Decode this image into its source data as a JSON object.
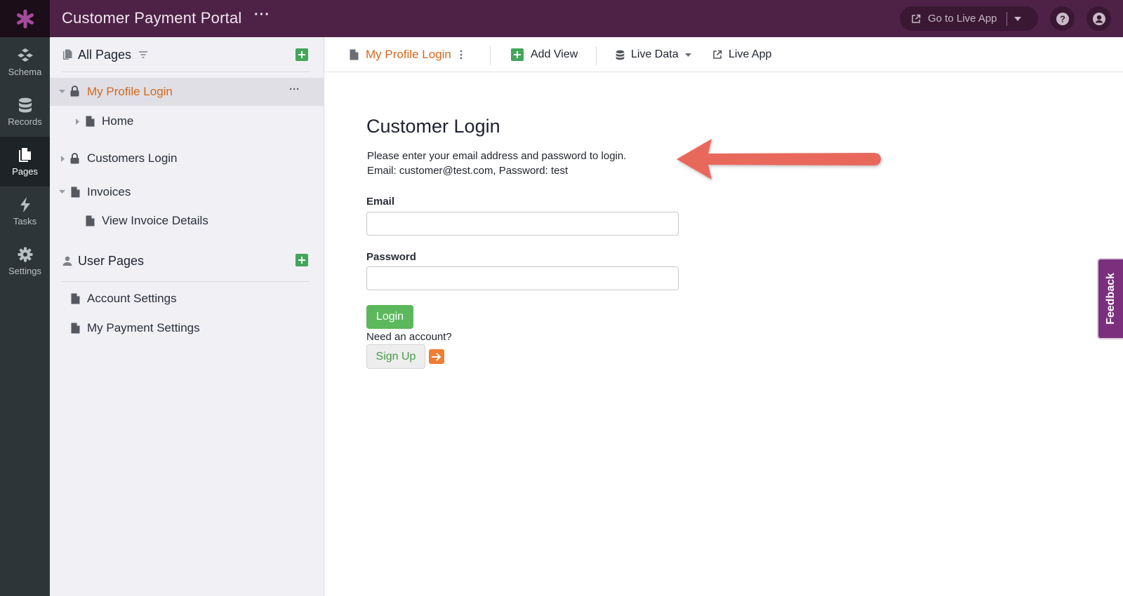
{
  "app": {
    "title": "Customer Payment Portal",
    "more_label": "···",
    "go_live_label": "Go to Live App",
    "accent": "#4e2247"
  },
  "leftnav": {
    "items": [
      {
        "label": "Schema",
        "icon": "schema-icon"
      },
      {
        "label": "Records",
        "icon": "database-icon"
      },
      {
        "label": "Pages",
        "icon": "pages-icon",
        "active": true
      },
      {
        "label": "Tasks",
        "icon": "bolt-icon"
      },
      {
        "label": "Settings",
        "icon": "gear-icon"
      }
    ]
  },
  "pages_panel": {
    "all_pages_title": "All Pages",
    "user_pages_title": "User Pages",
    "tree": [
      {
        "label": "My Profile Login",
        "selected": true,
        "more": "···"
      },
      {
        "label": "Home"
      },
      {
        "label": "Customers Login"
      },
      {
        "label": "Invoices"
      },
      {
        "label": "View Invoice Details"
      }
    ],
    "user_pages": [
      {
        "label": "Account Settings"
      },
      {
        "label": "My Payment Settings"
      }
    ]
  },
  "toolbar": {
    "page_name": "My Profile Login",
    "add_view": "Add View",
    "live_data": "Live Data",
    "live_app": "Live App"
  },
  "login": {
    "title": "Customer Login",
    "desc_line1": "Please enter your email address and password to login.",
    "desc_line2": "Email: customer@test.com, Password: test",
    "email_label": "Email",
    "email_value": "",
    "password_label": "Password",
    "password_value": "",
    "login_button": "Login",
    "need_account": "Need an account?",
    "signup_button": "Sign Up"
  },
  "feedback_label": "Feedback"
}
